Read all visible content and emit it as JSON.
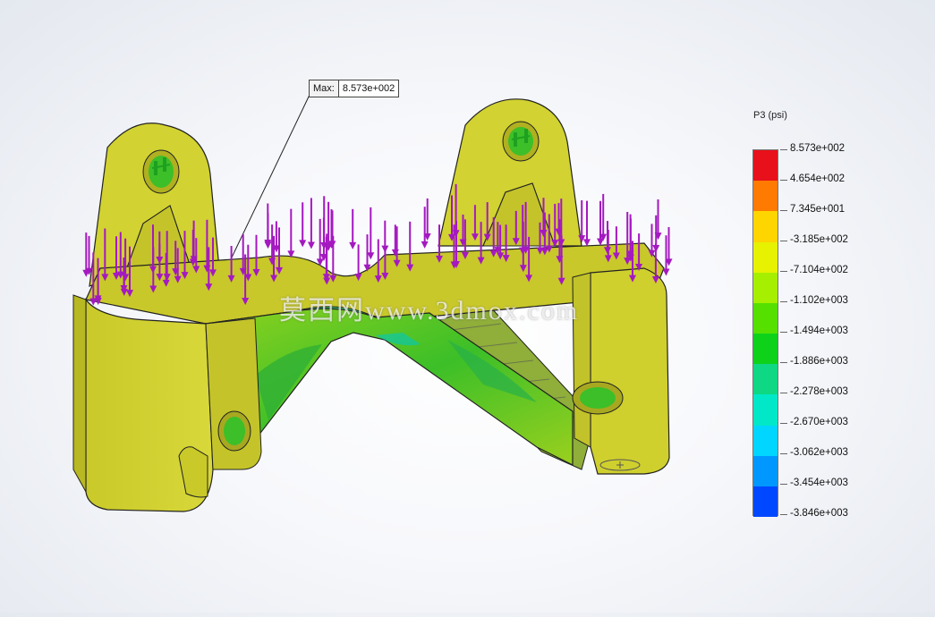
{
  "result_plot": {
    "legend": {
      "title": "P3 (psi)",
      "levels": [
        {
          "value": "8.573e+002",
          "color": "#e8101a"
        },
        {
          "value": "4.654e+002",
          "color": "#ff7a00"
        },
        {
          "value": "7.345e+001",
          "color": "#ffd500"
        },
        {
          "value": "-3.185e+002",
          "color": "#e6f200"
        },
        {
          "value": "-7.104e+002",
          "color": "#a6ef00"
        },
        {
          "value": "-1.102e+003",
          "color": "#55e000"
        },
        {
          "value": "-1.494e+003",
          "color": "#0ed21a"
        },
        {
          "value": "-1.886e+003",
          "color": "#0ed884"
        },
        {
          "value": "-2.278e+003",
          "color": "#00e8c8"
        },
        {
          "value": "-2.670e+003",
          "color": "#00d6ff"
        },
        {
          "value": "-3.062e+003",
          "color": "#0098ff"
        },
        {
          "value": "-3.454e+003",
          "color": "#0048ff"
        },
        {
          "value": "-3.846e+003",
          "color": "#0a0aff"
        }
      ]
    },
    "max_annotation": {
      "label": "Max:",
      "value": "8.573e+002"
    },
    "watermark": "莫西网www.3dmox.com",
    "colors": {
      "part_yellow": "#d2d232",
      "part_yellow_dark": "#a9a91c",
      "stress_green": "#3cbf28",
      "load_arrow": "#a419c0",
      "fixture": "#1ea020"
    }
  }
}
